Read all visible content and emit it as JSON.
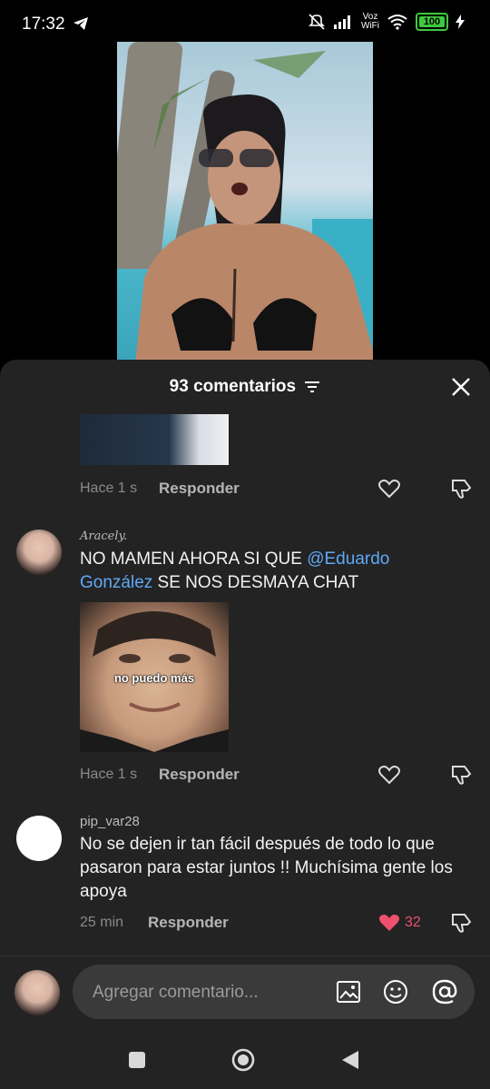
{
  "status_bar": {
    "time": "17:32",
    "voz_line1": "Voz",
    "voz_line2": "WiFi",
    "battery": "100"
  },
  "comments_header": {
    "count_label": "93 comentarios"
  },
  "comments": [
    {
      "time": "Hace 1 s",
      "reply_label": "Responder"
    },
    {
      "username": "Aracely.",
      "text_before": "NO MAMEN AHORA SI QUE ",
      "mention": "@Eduardo González",
      "text_after": " SE NOS DESMAYA CHAT",
      "meme_caption": "no puedo más",
      "time": "Hace 1 s",
      "reply_label": "Responder"
    },
    {
      "username": "pip_var28",
      "text": "No se dejen ir tan fácil después de todo lo que pasaron para estar juntos !! Muchísima gente los apoya",
      "time": "25 min",
      "reply_label": "Responder",
      "likes": "32"
    }
  ],
  "comment_input": {
    "placeholder": "Agregar comentario..."
  },
  "colors": {
    "accent_mention": "#5fa8f5",
    "like_red": "#f0506e",
    "sheet_bg": "#232323"
  }
}
